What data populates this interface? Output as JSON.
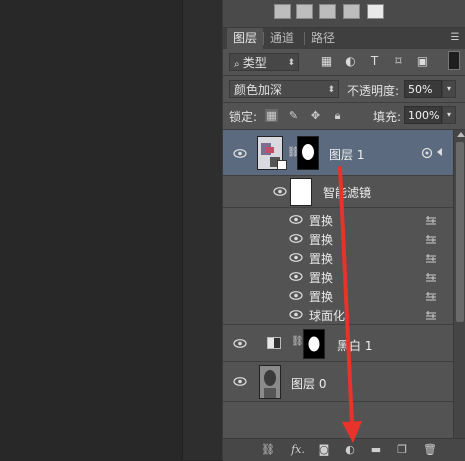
{
  "tabs": [
    "图层",
    "通道",
    "路径"
  ],
  "filter": {
    "kind_label": "类型",
    "search_icon": "search-icon"
  },
  "blend": {
    "mode": "颜色加深",
    "opacity_label": "不透明度:",
    "opacity_value": "50%"
  },
  "lock": {
    "label": "锁定:",
    "fill_label": "填充:",
    "fill_value": "100%"
  },
  "layers": [
    {
      "name": "图层 1",
      "selected": true,
      "type": "smart-object"
    },
    {
      "name": "智能滤镜",
      "type": "smart-filters"
    },
    {
      "name": "置换",
      "type": "filter"
    },
    {
      "name": "置换",
      "type": "filter"
    },
    {
      "name": "置换",
      "type": "filter"
    },
    {
      "name": "置换",
      "type": "filter"
    },
    {
      "name": "置换",
      "type": "filter"
    },
    {
      "name": "球面化",
      "type": "filter"
    },
    {
      "name": "黑白 1",
      "type": "adjustment"
    },
    {
      "name": "图层 0",
      "type": "pixel"
    }
  ],
  "bottom_icons": [
    "link-icon",
    "fx-icon",
    "mask-icon",
    "adjustment-icon",
    "folder-icon",
    "new-layer-icon",
    "trash-icon"
  ],
  "bottom_fx_label": "fx.",
  "annotation_color": "#e8332b"
}
